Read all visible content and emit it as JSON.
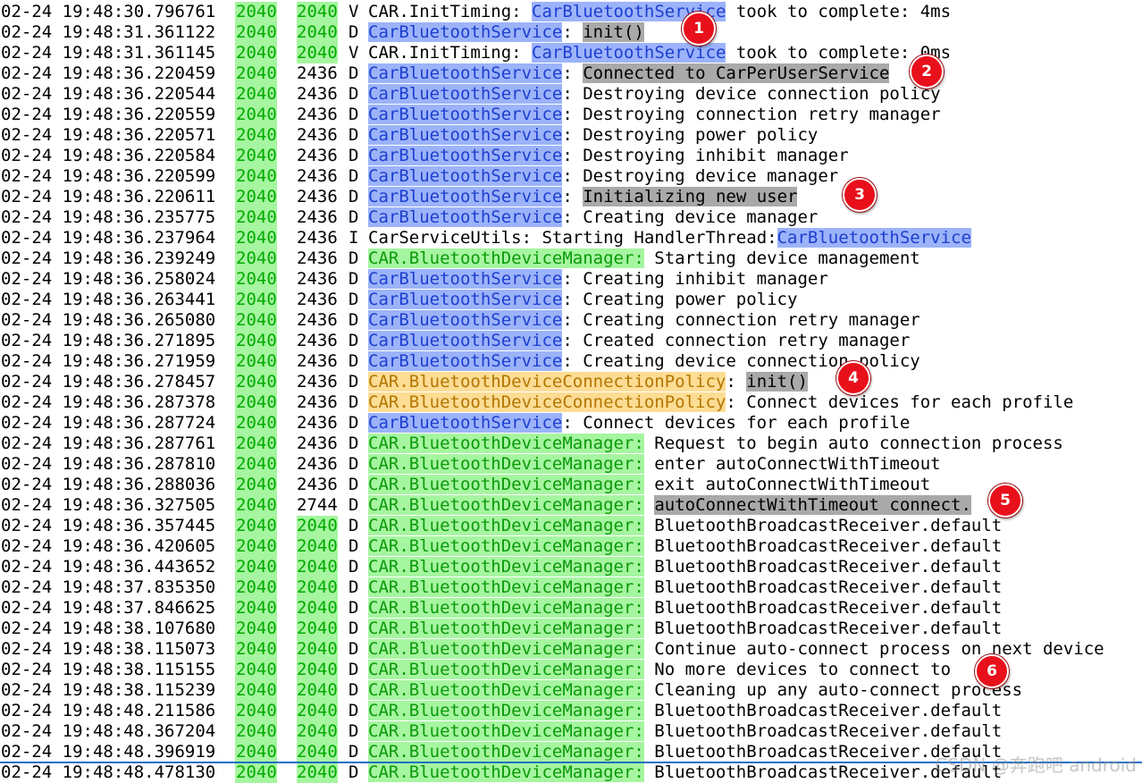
{
  "log": {
    "rows": [
      {
        "date": "02-24 19:48:30.796761",
        "pid": "2040",
        "tid": "2040",
        "level": "V",
        "tag": "CAR.InitTiming:",
        "tag_style": "plain",
        "segments": [
          {
            "text": " "
          },
          {
            "text": "CarBluetoothService",
            "style": "blue"
          },
          {
            "text": " took to complete: 4ms"
          }
        ]
      },
      {
        "date": "02-24 19:48:31.361122",
        "pid": "2040",
        "tid": "2040",
        "level": "D",
        "tag": "CarBluetoothService",
        "tag_style": "blue",
        "segments": [
          {
            "text": ": "
          },
          {
            "text": "init()",
            "style": "grey"
          }
        ]
      },
      {
        "date": "02-24 19:48:31.361145",
        "pid": "2040",
        "tid": "2040",
        "level": "V",
        "tag": "CAR.InitTiming:",
        "tag_style": "plain",
        "segments": [
          {
            "text": " "
          },
          {
            "text": "CarBluetoothService",
            "style": "blue"
          },
          {
            "text": " took to complete: 0ms"
          }
        ]
      },
      {
        "date": "02-24 19:48:36.220459",
        "pid": "2040",
        "tid": "2436",
        "level": "D",
        "tag": "CarBluetoothService",
        "tag_style": "blue",
        "segments": [
          {
            "text": ": "
          },
          {
            "text": "Connected to CarPerUserService",
            "style": "grey"
          }
        ]
      },
      {
        "date": "02-24 19:48:36.220544",
        "pid": "2040",
        "tid": "2436",
        "level": "D",
        "tag": "CarBluetoothService",
        "tag_style": "blue",
        "segments": [
          {
            "text": ": Destroying device connection policy"
          }
        ]
      },
      {
        "date": "02-24 19:48:36.220559",
        "pid": "2040",
        "tid": "2436",
        "level": "D",
        "tag": "CarBluetoothService",
        "tag_style": "blue",
        "segments": [
          {
            "text": ": Destroying connection retry manager"
          }
        ]
      },
      {
        "date": "02-24 19:48:36.220571",
        "pid": "2040",
        "tid": "2436",
        "level": "D",
        "tag": "CarBluetoothService",
        "tag_style": "blue",
        "segments": [
          {
            "text": ": Destroying power policy"
          }
        ]
      },
      {
        "date": "02-24 19:48:36.220584",
        "pid": "2040",
        "tid": "2436",
        "level": "D",
        "tag": "CarBluetoothService",
        "tag_style": "blue",
        "segments": [
          {
            "text": ": Destroying inhibit manager"
          }
        ]
      },
      {
        "date": "02-24 19:48:36.220599",
        "pid": "2040",
        "tid": "2436",
        "level": "D",
        "tag": "CarBluetoothService",
        "tag_style": "blue",
        "segments": [
          {
            "text": ": Destroying device manager"
          }
        ]
      },
      {
        "date": "02-24 19:48:36.220611",
        "pid": "2040",
        "tid": "2436",
        "level": "D",
        "tag": "CarBluetoothService",
        "tag_style": "blue",
        "segments": [
          {
            "text": ": "
          },
          {
            "text": "Initializing new user",
            "style": "grey"
          }
        ]
      },
      {
        "date": "02-24 19:48:36.235775",
        "pid": "2040",
        "tid": "2436",
        "level": "D",
        "tag": "CarBluetoothService",
        "tag_style": "blue",
        "segments": [
          {
            "text": ": Creating device manager"
          }
        ]
      },
      {
        "date": "02-24 19:48:36.237964",
        "pid": "2040",
        "tid": "2436",
        "level": "I",
        "tag": "CarServiceUtils:",
        "tag_style": "plain",
        "segments": [
          {
            "text": " Starting HandlerThread:"
          },
          {
            "text": "CarBluetoothService",
            "style": "blue"
          }
        ]
      },
      {
        "date": "02-24 19:48:36.239249",
        "pid": "2040",
        "tid": "2436",
        "level": "D",
        "tag": "CAR.BluetoothDeviceManager:",
        "tag_style": "green",
        "segments": [
          {
            "text": " Starting device management"
          }
        ]
      },
      {
        "date": "02-24 19:48:36.258024",
        "pid": "2040",
        "tid": "2436",
        "level": "D",
        "tag": "CarBluetoothService",
        "tag_style": "blue",
        "segments": [
          {
            "text": ": Creating inhibit manager"
          }
        ]
      },
      {
        "date": "02-24 19:48:36.263441",
        "pid": "2040",
        "tid": "2436",
        "level": "D",
        "tag": "CarBluetoothService",
        "tag_style": "blue",
        "segments": [
          {
            "text": ": Creating power policy"
          }
        ]
      },
      {
        "date": "02-24 19:48:36.265080",
        "pid": "2040",
        "tid": "2436",
        "level": "D",
        "tag": "CarBluetoothService",
        "tag_style": "blue",
        "segments": [
          {
            "text": ": Creating connection retry manager"
          }
        ]
      },
      {
        "date": "02-24 19:48:36.271895",
        "pid": "2040",
        "tid": "2436",
        "level": "D",
        "tag": "CarBluetoothService",
        "tag_style": "blue",
        "segments": [
          {
            "text": ": Created connection retry manager"
          }
        ]
      },
      {
        "date": "02-24 19:48:36.271959",
        "pid": "2040",
        "tid": "2436",
        "level": "D",
        "tag": "CarBluetoothService",
        "tag_style": "blue",
        "segments": [
          {
            "text": ": Creating device connection policy"
          }
        ]
      },
      {
        "date": "02-24 19:48:36.278457",
        "pid": "2040",
        "tid": "2436",
        "level": "D",
        "tag": "CAR.BluetoothDeviceConnectionPolicy",
        "tag_style": "orange",
        "segments": [
          {
            "text": ": "
          },
          {
            "text": "init()",
            "style": "grey"
          }
        ]
      },
      {
        "date": "02-24 19:48:36.287378",
        "pid": "2040",
        "tid": "2436",
        "level": "D",
        "tag": "CAR.BluetoothDeviceConnectionPolicy",
        "tag_style": "orange",
        "segments": [
          {
            "text": ": Connect devices for each profile"
          }
        ]
      },
      {
        "date": "02-24 19:48:36.287724",
        "pid": "2040",
        "tid": "2436",
        "level": "D",
        "tag": "CarBluetoothService",
        "tag_style": "blue",
        "segments": [
          {
            "text": ": Connect devices for each profile"
          }
        ]
      },
      {
        "date": "02-24 19:48:36.287761",
        "pid": "2040",
        "tid": "2436",
        "level": "D",
        "tag": "CAR.BluetoothDeviceManager:",
        "tag_style": "green",
        "segments": [
          {
            "text": " Request to begin auto connection process"
          }
        ]
      },
      {
        "date": "02-24 19:48:36.287810",
        "pid": "2040",
        "tid": "2436",
        "level": "D",
        "tag": "CAR.BluetoothDeviceManager:",
        "tag_style": "green",
        "segments": [
          {
            "text": " enter autoConnectWithTimeout"
          }
        ]
      },
      {
        "date": "02-24 19:48:36.288036",
        "pid": "2040",
        "tid": "2436",
        "level": "D",
        "tag": "CAR.BluetoothDeviceManager:",
        "tag_style": "green",
        "segments": [
          {
            "text": " exit autoConnectWithTimeout"
          }
        ]
      },
      {
        "date": "02-24 19:48:36.327505",
        "pid": "2040",
        "tid": "2744",
        "level": "D",
        "tag": "CAR.BluetoothDeviceManager:",
        "tag_style": "green",
        "segments": [
          {
            "text": " "
          },
          {
            "text": "autoConnectWithTimeout connect.",
            "style": "grey"
          }
        ]
      },
      {
        "date": "02-24 19:48:36.357445",
        "pid": "2040",
        "tid": "2040",
        "level": "D",
        "tag": "CAR.BluetoothDeviceManager:",
        "tag_style": "green",
        "segments": [
          {
            "text": " BluetoothBroadcastReceiver.default"
          }
        ]
      },
      {
        "date": "02-24 19:48:36.420605",
        "pid": "2040",
        "tid": "2040",
        "level": "D",
        "tag": "CAR.BluetoothDeviceManager:",
        "tag_style": "green",
        "segments": [
          {
            "text": " BluetoothBroadcastReceiver.default"
          }
        ]
      },
      {
        "date": "02-24 19:48:36.443652",
        "pid": "2040",
        "tid": "2040",
        "level": "D",
        "tag": "CAR.BluetoothDeviceManager:",
        "tag_style": "green",
        "segments": [
          {
            "text": " BluetoothBroadcastReceiver.default"
          }
        ]
      },
      {
        "date": "02-24 19:48:37.835350",
        "pid": "2040",
        "tid": "2040",
        "level": "D",
        "tag": "CAR.BluetoothDeviceManager:",
        "tag_style": "green",
        "segments": [
          {
            "text": " BluetoothBroadcastReceiver.default"
          }
        ]
      },
      {
        "date": "02-24 19:48:37.846625",
        "pid": "2040",
        "tid": "2040",
        "level": "D",
        "tag": "CAR.BluetoothDeviceManager:",
        "tag_style": "green",
        "segments": [
          {
            "text": " BluetoothBroadcastReceiver.default"
          }
        ]
      },
      {
        "date": "02-24 19:48:38.107680",
        "pid": "2040",
        "tid": "2040",
        "level": "D",
        "tag": "CAR.BluetoothDeviceManager:",
        "tag_style": "green",
        "segments": [
          {
            "text": " BluetoothBroadcastReceiver.default"
          }
        ]
      },
      {
        "date": "02-24 19:48:38.115073",
        "pid": "2040",
        "tid": "2040",
        "level": "D",
        "tag": "CAR.BluetoothDeviceManager:",
        "tag_style": "green",
        "segments": [
          {
            "text": " Continue auto-connect process on next device"
          }
        ]
      },
      {
        "date": "02-24 19:48:38.115155",
        "pid": "2040",
        "tid": "2040",
        "level": "D",
        "tag": "CAR.BluetoothDeviceManager:",
        "tag_style": "green",
        "segments": [
          {
            "text": " No more devices to connect to"
          }
        ]
      },
      {
        "date": "02-24 19:48:38.115239",
        "pid": "2040",
        "tid": "2040",
        "level": "D",
        "tag": "CAR.BluetoothDeviceManager:",
        "tag_style": "green",
        "segments": [
          {
            "text": " Cleaning up any auto-connect process"
          }
        ]
      },
      {
        "date": "02-24 19:48:48.211586",
        "pid": "2040",
        "tid": "2040",
        "level": "D",
        "tag": "CAR.BluetoothDeviceManager:",
        "tag_style": "green",
        "segments": [
          {
            "text": " BluetoothBroadcastReceiver.default"
          }
        ]
      },
      {
        "date": "02-24 19:48:48.367204",
        "pid": "2040",
        "tid": "2040",
        "level": "D",
        "tag": "CAR.BluetoothDeviceManager:",
        "tag_style": "green",
        "segments": [
          {
            "text": " BluetoothBroadcastReceiver.default"
          }
        ]
      },
      {
        "date": "02-24 19:48:48.396919",
        "pid": "2040",
        "tid": "2040",
        "level": "D",
        "tag": "CAR.BluetoothDeviceManager:",
        "tag_style": "green",
        "segments": [
          {
            "text": " BluetoothBroadcastReceiver.default"
          }
        ]
      },
      {
        "date": "02-24 19:48:48.478130",
        "pid": "2040",
        "tid": "2040",
        "level": "D",
        "tag": "CAR.BluetoothDeviceManager:",
        "tag_style": "green",
        "segments": [
          {
            "text": " BluetoothBroadcastReceiver.default"
          }
        ]
      }
    ]
  },
  "annotations": [
    "1",
    "2",
    "3",
    "4",
    "5",
    "6"
  ],
  "watermark": "CSDN @奔跑吧 android",
  "colors": {
    "tag_blue_bg": "#9cb3fa",
    "tag_green_bg": "#a6f5a0",
    "tag_orange_bg": "#fddc94",
    "highlight_grey": "#a9a9a9",
    "badge_red": "#e8101a",
    "separator_blue": "#1f6fc6"
  }
}
